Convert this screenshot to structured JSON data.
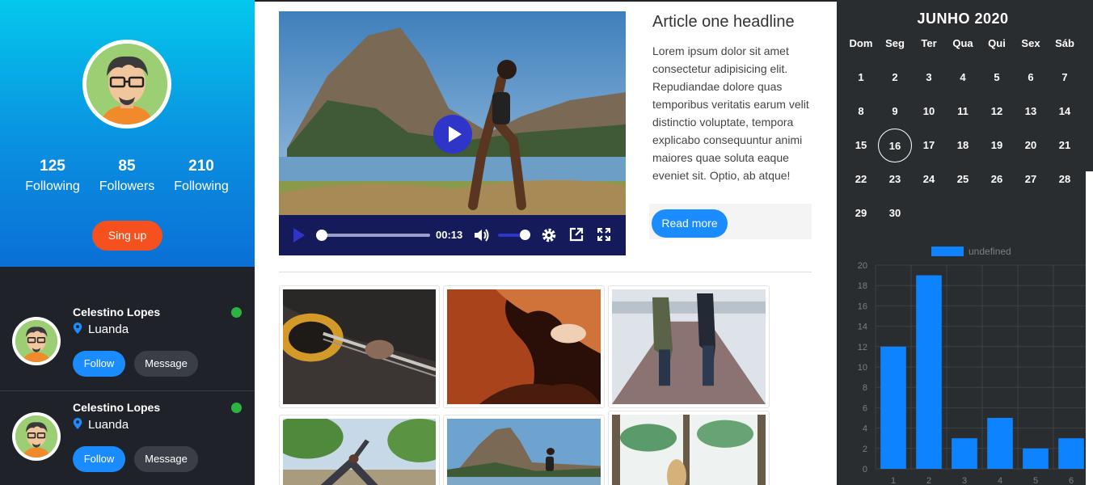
{
  "profile": {
    "stats": [
      {
        "value": "125",
        "label": "Following"
      },
      {
        "value": "85",
        "label": "Followers"
      },
      {
        "value": "210",
        "label": "Following"
      }
    ],
    "signup_label": "Sing up"
  },
  "people": [
    {
      "name": "Celestino Lopes",
      "city": "Luanda",
      "follow_label": "Follow",
      "message_label": "Message",
      "status": "online"
    },
    {
      "name": "Celestino Lopes",
      "city": "Luanda",
      "follow_label": "Follow",
      "message_label": "Message",
      "status": "online"
    }
  ],
  "video": {
    "time": "00:13",
    "progress": 0.0,
    "volume": 1.0
  },
  "article": {
    "headline": "Article one headline",
    "body": "Lorem ipsum dolor sit amet consectetur adipisicing elit. Repudiandae dolore quas temporibus veritatis earum velit distinctio voluptate, tempora explicabo consequuntur animi maiores quae soluta eaque eveniet sit. Optio, ab atque!",
    "read_more_label": "Read more"
  },
  "gallery": [
    {
      "subject": "bass guitar"
    },
    {
      "subject": "canyon"
    },
    {
      "subject": "couple on pier"
    },
    {
      "subject": "yoga in park"
    },
    {
      "subject": "runner by mountain"
    },
    {
      "subject": "window with palms"
    }
  ],
  "calendar": {
    "title": "JUNHO 2020",
    "weekdays": [
      "Dom",
      "Seg",
      "Ter",
      "Qua",
      "Qui",
      "Sex",
      "Sáb"
    ],
    "days": [
      "1",
      "2",
      "3",
      "4",
      "5",
      "6",
      "7",
      "8",
      "9",
      "10",
      "11",
      "12",
      "13",
      "14",
      "15",
      "16",
      "17",
      "18",
      "19",
      "20",
      "21",
      "22",
      "23",
      "24",
      "25",
      "26",
      "27",
      "28",
      "29",
      "30"
    ],
    "selected_day": "16"
  },
  "chart_data": {
    "type": "bar",
    "categories": [
      "1",
      "2",
      "3",
      "4",
      "5",
      "6"
    ],
    "series": [
      {
        "name": "undefined",
        "values": [
          12,
          19,
          3,
          5,
          2,
          3
        ]
      }
    ],
    "ylim": [
      0,
      20
    ],
    "yticks": [
      "0",
      "2",
      "4",
      "6",
      "8",
      "10",
      "12",
      "14",
      "16",
      "18",
      "20"
    ],
    "color": "#0d83ff",
    "grid": true,
    "legend": "top"
  },
  "colors": {
    "accent": "#1a8cff",
    "signup": "#f4511e",
    "online": "#2bb441",
    "dark_panel": "#1f2329",
    "calendar_bg": "#2a2d30"
  }
}
